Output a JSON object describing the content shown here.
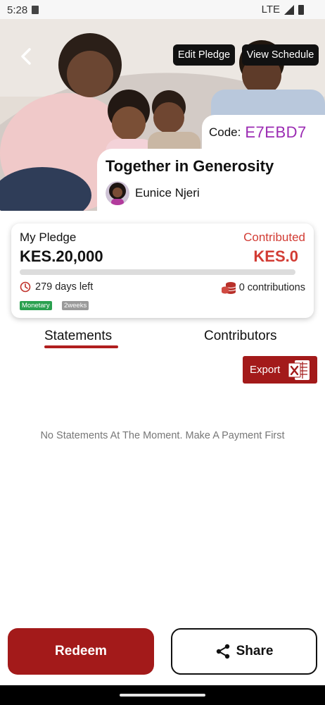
{
  "status_bar": {
    "time": "5:28",
    "network": "LTE"
  },
  "header": {
    "edit_label": "Edit Pledge",
    "schedule_label": "View Schedule",
    "code_label": "Code:",
    "code_value": "E7EBD7"
  },
  "pledge": {
    "title": "Together in Generosity",
    "owner": "Eunice Njeri",
    "my_pledge_label": "My Pledge",
    "my_pledge_amount": "KES.20,000",
    "contributed_label": "Contributed",
    "contributed_amount": "KES.0",
    "progress_fraction": 0,
    "days_left": "279 days left",
    "contributions": "0 contributions",
    "type_tag": "Monetary",
    "frequency_tag": "2weeks"
  },
  "tabs": [
    {
      "label": "Statements",
      "active": true
    },
    {
      "label": "Contributors",
      "active": false
    }
  ],
  "export_label": "Export",
  "empty_message": "No Statements At The Moment. Make A Payment First",
  "actions": {
    "redeem_label": "Redeem",
    "share_label": "Share"
  },
  "colors": {
    "brand_red": "#a31a1a",
    "contributed_red": "#d23c34",
    "code_purple": "#9b2bb3",
    "tag_green": "#2aa04f"
  }
}
